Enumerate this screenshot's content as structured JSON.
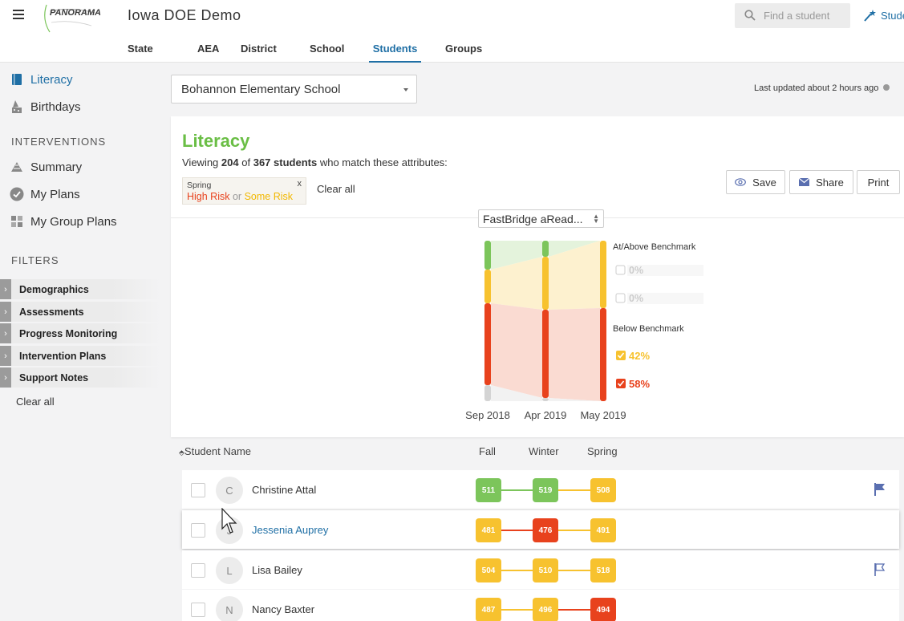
{
  "header": {
    "app_title": "Iowa DOE Demo",
    "logo_text": "PANORAMA",
    "search_placeholder": "Find a student",
    "studio_label": "Student",
    "tabs": [
      "State",
      "AEA",
      "District",
      "School",
      "Students",
      "Groups"
    ],
    "active_tab": "Students"
  },
  "sidebar": {
    "items": [
      {
        "label": "Literacy",
        "icon": "book-icon",
        "active": true
      },
      {
        "label": "Birthdays",
        "icon": "cake-icon",
        "active": false
      }
    ],
    "interventions_heading": "INTERVENTIONS",
    "intervention_items": [
      {
        "label": "Summary",
        "icon": "summary-icon"
      },
      {
        "label": "My Plans",
        "icon": "check-circle-icon"
      },
      {
        "label": "My Group Plans",
        "icon": "grid-icon"
      }
    ],
    "filters_heading": "FILTERS",
    "filters": [
      "Demographics",
      "Assessments",
      "Progress Monitoring",
      "Intervention Plans",
      "Support Notes"
    ],
    "clear_all": "Clear all"
  },
  "school_select": {
    "value": "Bohannon Elementary School"
  },
  "last_updated": "Last updated about 2 hours ago",
  "literacy": {
    "title": "Literacy",
    "viewing_prefix": "Viewing",
    "viewing_count": "204",
    "viewing_of": "of",
    "viewing_total": "367 students",
    "viewing_suffix": "who match these attributes:",
    "chip": {
      "season": "Spring",
      "high_risk": "High Risk",
      "or": "or",
      "some_risk": "Some Risk",
      "close": "x"
    },
    "clear_all": "Clear all",
    "buttons": {
      "save": "Save",
      "share": "Share",
      "print": "Print"
    },
    "assessment_select": "FastBridge aRead..."
  },
  "chart_data": {
    "type": "area",
    "x": [
      "Sep 2018",
      "Apr 2019",
      "May 2019"
    ],
    "series": [
      {
        "name": "At/Above Benchmark",
        "values": [
          0.18,
          0.1,
          0.0
        ],
        "color": "#7cc55b"
      },
      {
        "name": "Some Risk",
        "values": [
          0.21,
          0.33,
          0.42
        ],
        "color": "#f7c22f"
      },
      {
        "name": "High Risk",
        "values": [
          0.51,
          0.55,
          0.58
        ],
        "color": "#e8421d"
      }
    ],
    "legend": {
      "above_heading": "At/Above Benchmark",
      "above": [
        {
          "label": "0%",
          "color": "#7cc55b",
          "checked": false
        },
        {
          "label": "0%",
          "color": "#d7ecc9",
          "checked": false
        }
      ],
      "below_heading": "Below Benchmark",
      "below": [
        {
          "label": "42%",
          "color": "#f7c22f",
          "checked": true
        },
        {
          "label": "58%",
          "color": "#e8421d",
          "checked": true
        }
      ]
    }
  },
  "table": {
    "headers": {
      "name": "Student Name",
      "fall": "Fall",
      "winter": "Winter",
      "spring": "Spring"
    },
    "rows": [
      {
        "initial": "C",
        "name": "Christine Attal",
        "link": false,
        "scores": [
          {
            "v": "511",
            "c": "#7cc55b"
          },
          {
            "v": "519",
            "c": "#7cc55b"
          },
          {
            "v": "508",
            "c": "#f7c22f"
          }
        ],
        "flag": "filled"
      },
      {
        "initial": "J",
        "name": "Jessenia Auprey",
        "link": true,
        "scores": [
          {
            "v": "481",
            "c": "#f7c22f"
          },
          {
            "v": "476",
            "c": "#e8421d"
          },
          {
            "v": "491",
            "c": "#f7c22f"
          }
        ],
        "flag": "none"
      },
      {
        "initial": "L",
        "name": "Lisa Bailey",
        "link": false,
        "scores": [
          {
            "v": "504",
            "c": "#f7c22f"
          },
          {
            "v": "510",
            "c": "#f7c22f"
          },
          {
            "v": "518",
            "c": "#f7c22f"
          }
        ],
        "flag": "outline"
      },
      {
        "initial": "N",
        "name": "Nancy Baxter",
        "link": false,
        "scores": [
          {
            "v": "487",
            "c": "#f7c22f"
          },
          {
            "v": "496",
            "c": "#f7c22f"
          },
          {
            "v": "494",
            "c": "#e8421d"
          }
        ],
        "flag": "none"
      }
    ]
  },
  "colors": {
    "accent": "#1f6fa5",
    "green": "#7cc55b",
    "yellow": "#f7c22f",
    "red": "#e8421d"
  }
}
